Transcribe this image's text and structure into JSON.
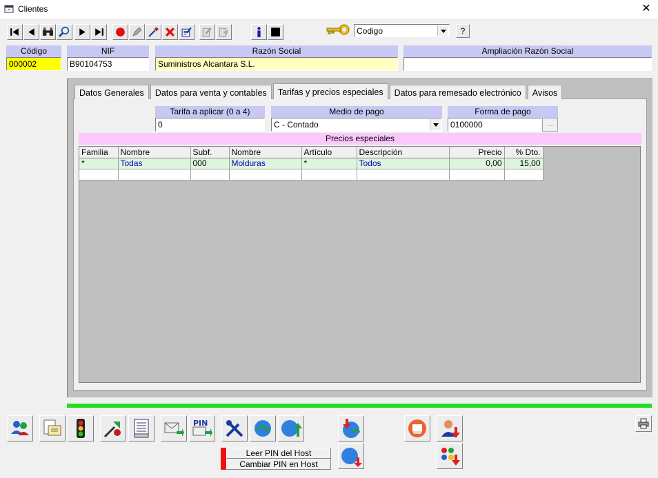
{
  "window": {
    "title": "Clientes",
    "close_glyph": "✕"
  },
  "toolbar": {
    "icons": [
      "first-record-icon",
      "previous-record-icon",
      "find-icon",
      "zoom-icon",
      "next-record-icon",
      "last-record-icon",
      "record-icon",
      "edit-icon",
      "pick-icon",
      "delete-icon",
      "edit-document-icon",
      "copy-icon",
      "paste-icon",
      "info-icon",
      "stop-icon"
    ],
    "key_icon": "key-icon",
    "search_field": "Codigo",
    "help_label": "?"
  },
  "header": {
    "codigo_label": "Código",
    "codigo_value": "000002",
    "nif_label": "NIF",
    "nif_value": "B90104753",
    "razon_label": "Razón Social",
    "razon_value": "Suministros Alcantara S.L.",
    "ampliacion_label": "Ampliación Razón Social",
    "ampliacion_value": ""
  },
  "tabs": [
    {
      "label": "Datos Generales",
      "active": false
    },
    {
      "label": "Datos para venta y contables",
      "active": false
    },
    {
      "label": "Tarifas y precios especiales",
      "active": true
    },
    {
      "label": "Datos para remesado electrónico",
      "active": false
    },
    {
      "label": "Avisos",
      "active": false
    }
  ],
  "tarifas": {
    "tarifa_label": "Tarifa a aplicar (0 a 4)",
    "tarifa_value": "0",
    "medio_label": "Medio de pago",
    "medio_value": "C - Contado",
    "forma_label": "Forma de pago",
    "forma_value": "0100000",
    "forma_btn": "..."
  },
  "precios": {
    "title": "Precios especiales",
    "columns": [
      "Familia",
      "Nombre",
      "Subf.",
      "Nombre",
      "Artículo",
      "Descripción",
      "Precio",
      "% Dto."
    ],
    "rows": [
      [
        "*",
        "Todas",
        "000",
        "Molduras",
        "*",
        "Todos",
        "0,00",
        "15,00"
      ]
    ]
  },
  "bottom": {
    "pin_read": "Leer PIN del Host",
    "pin_change": "Cambiar PIN en Host",
    "pin_icon_text": "PIN"
  },
  "colors": {
    "label_bg": "#c8c8f4",
    "yellow": "#ffff00",
    "light_yellow": "#ffffc0",
    "pink": "#fac8fa",
    "green_bar": "#22dd22"
  }
}
